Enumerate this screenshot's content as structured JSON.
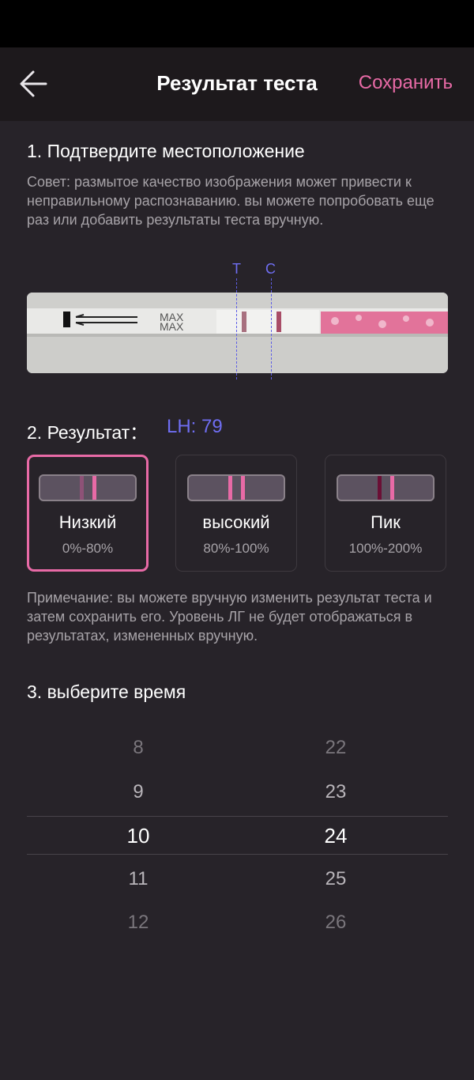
{
  "header": {
    "title": "Результат теста",
    "save_label": "Сохранить"
  },
  "step1": {
    "title": "1. Подтвердите местоположение",
    "tip": "Совет: размытое качество изображения может привести к неправильному распознаванию. вы можете попробовать еще раз или добавить результаты теста вручную.",
    "marker_t": "T",
    "marker_c": "C",
    "strip_text_1": "MAX",
    "strip_text_2": "MAX"
  },
  "step2": {
    "title": "2. Результат：",
    "lh_value": "LH: 79",
    "options": [
      {
        "name": "Низкий",
        "range": "0%-80%",
        "selected": true
      },
      {
        "name": "высокий",
        "range": "80%-100%",
        "selected": false
      },
      {
        "name": "Пик",
        "range": "100%-200%",
        "selected": false
      }
    ],
    "note": "Примечание: вы можете вручную изменить результат теста и затем сохранить его. Уровень ЛГ не будет отображаться в результатах, измененных вручную."
  },
  "step3": {
    "title": "3. выберите время",
    "hours": [
      "8",
      "9",
      "10",
      "11",
      "12"
    ],
    "minutes": [
      "22",
      "23",
      "24",
      "25",
      "26"
    ],
    "selected_hour": "10",
    "selected_minute": "24"
  },
  "colors": {
    "accent": "#e86aa6",
    "lh_blue": "#6f6ef2",
    "background": "#272329"
  }
}
